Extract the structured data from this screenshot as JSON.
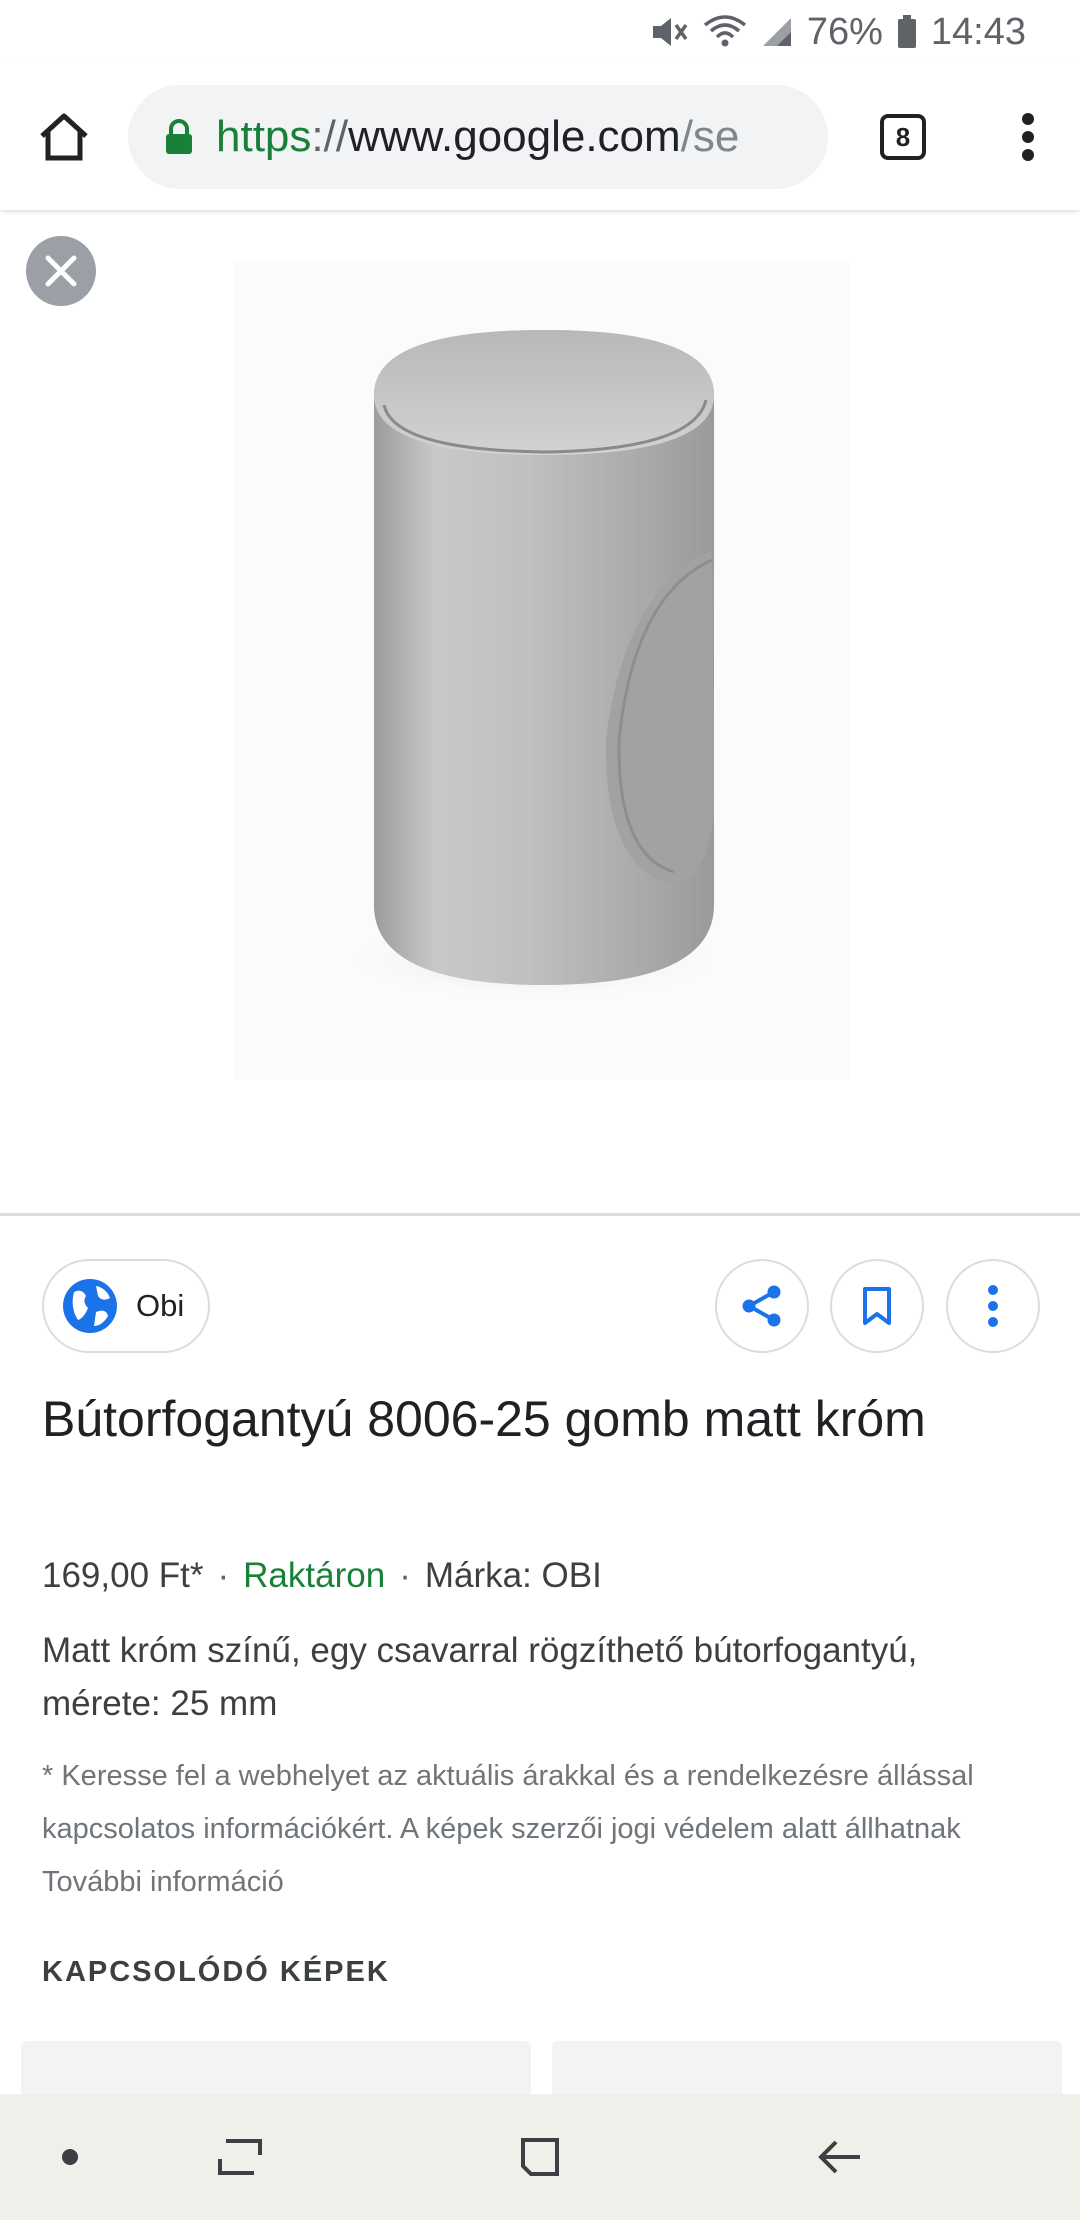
{
  "status_bar": {
    "battery_percent": "76%",
    "time": "14:43",
    "icons": [
      "mute-icon",
      "wifi-icon",
      "signal-icon",
      "battery-icon"
    ]
  },
  "browser": {
    "url_scheme": "https",
    "url_separator": "://",
    "url_host": "www.google.com",
    "url_path": "/se",
    "tab_count": "8",
    "icons": [
      "home-icon",
      "lock-icon",
      "tabs-icon",
      "overflow-menu-icon"
    ]
  },
  "viewer": {
    "icons": [
      "close-icon"
    ]
  },
  "result": {
    "source_name": "Obi",
    "title": "Bútorfogantyú 8006-25 gomb matt króm",
    "price": "169,00 Ft*",
    "meta_separator": "·",
    "stock": "Raktáron",
    "brand": "Márka: OBI",
    "description": "Matt króm színű, egy csavarral rögzíthető bútorfogantyú, mérete: 25 mm",
    "disclaimer": "* Keresse fel a webhelyet az aktuális árakkal és a rendelkezésre állással kapcsolatos információkért. A képek szerzői jogi védelem alatt állhatnak További információ",
    "related_heading": "KAPCSOLÓDÓ KÉPEK",
    "icons": [
      "globe-icon",
      "share-icon",
      "bookmark-icon",
      "more-vert-icon"
    ]
  },
  "colors": {
    "accent_blue": "#1a73e8",
    "stock_green": "#188038",
    "secure_green": "#188038"
  },
  "nav_bar": {
    "icons": [
      "dot-icon",
      "recents-icon",
      "home-square-icon",
      "back-icon"
    ]
  }
}
